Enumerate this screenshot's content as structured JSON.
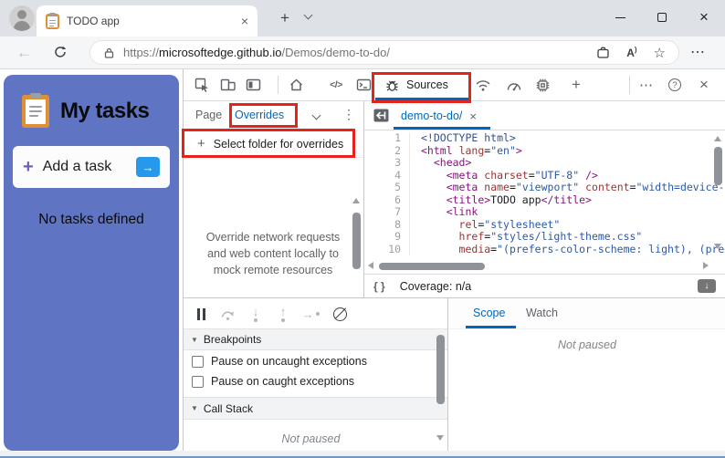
{
  "colors": {
    "accent": "#0067c0",
    "highlight": "#e5231b",
    "panel": "#5f75c3",
    "tk_tag": "#881280",
    "tk_attr": "#9a3333",
    "tk_val": "#2b59a8",
    "tk_doctype": "#33518e",
    "tk_plain": "#202124"
  },
  "browser": {
    "tab_title": "TODO app",
    "url": {
      "scheme": "https://",
      "host": "microsoftedge.github.io",
      "path": "/Demos/demo-to-do/"
    }
  },
  "app": {
    "title": "My tasks",
    "add_task": "Add a task",
    "empty": "No tasks defined"
  },
  "devtools": {
    "sources_tab": "Sources",
    "sidebar": {
      "page_tab": "Page",
      "overrides_tab": "Overrides",
      "select_folder": "Select folder for overrides",
      "placeholder": "Override network requests and web content locally to mock remote resources"
    },
    "editor": {
      "file_tab": "demo-to-do/",
      "coverage": "Coverage: n/a",
      "lines": [
        {
          "n": "1",
          "t": [
            [
              "doctype",
              "<!DOCTYPE html>"
            ]
          ]
        },
        {
          "n": "2",
          "t": [
            [
              "tag",
              "<html"
            ],
            [
              "plain",
              " "
            ],
            [
              "attr",
              "lang"
            ],
            [
              "plain",
              "="
            ],
            [
              "val",
              "\"en\""
            ],
            [
              "tag",
              ">"
            ]
          ]
        },
        {
          "n": "3",
          "t": [
            [
              "plain",
              "  "
            ],
            [
              "tag",
              "<head>"
            ]
          ]
        },
        {
          "n": "4",
          "t": [
            [
              "plain",
              "    "
            ],
            [
              "tag",
              "<meta"
            ],
            [
              "plain",
              " "
            ],
            [
              "attr",
              "charset"
            ],
            [
              "plain",
              "="
            ],
            [
              "val",
              "\"UTF-8\""
            ],
            [
              "tag",
              " />"
            ]
          ]
        },
        {
          "n": "5",
          "t": [
            [
              "plain",
              "    "
            ],
            [
              "tag",
              "<meta"
            ],
            [
              "plain",
              " "
            ],
            [
              "attr",
              "name"
            ],
            [
              "plain",
              "="
            ],
            [
              "val",
              "\"viewport\""
            ],
            [
              "plain",
              " "
            ],
            [
              "attr",
              "content"
            ],
            [
              "plain",
              "="
            ],
            [
              "val",
              "\"width=device-"
            ]
          ]
        },
        {
          "n": "6",
          "t": [
            [
              "plain",
              "    "
            ],
            [
              "tag",
              "<title>"
            ],
            [
              "plain",
              "TODO app"
            ],
            [
              "tag",
              "</title>"
            ]
          ]
        },
        {
          "n": "7",
          "t": [
            [
              "plain",
              "    "
            ],
            [
              "tag",
              "<link"
            ]
          ]
        },
        {
          "n": "8",
          "t": [
            [
              "plain",
              "      "
            ],
            [
              "attr",
              "rel"
            ],
            [
              "plain",
              "="
            ],
            [
              "val",
              "\"stylesheet\""
            ]
          ]
        },
        {
          "n": "9",
          "t": [
            [
              "plain",
              "      "
            ],
            [
              "attr",
              "href"
            ],
            [
              "plain",
              "="
            ],
            [
              "val",
              "\"styles/light-theme.css\""
            ]
          ]
        },
        {
          "n": "10",
          "t": [
            [
              "plain",
              "      "
            ],
            [
              "attr",
              "media"
            ],
            [
              "plain",
              "="
            ],
            [
              "val",
              "\"(prefers-color-scheme: light), (pre"
            ]
          ]
        }
      ]
    },
    "debugger": {
      "breakpoints_header": "Breakpoints",
      "checkboxes": [
        "Pause on uncaught exceptions",
        "Pause on caught exceptions"
      ],
      "callstack_header": "Call Stack",
      "not_paused": "Not paused"
    },
    "watch": {
      "tabs": [
        "Scope",
        "Watch"
      ],
      "not_paused": "Not paused"
    }
  },
  "icons": {
    "plus": "+",
    "close": "×",
    "more_h": "⋯",
    "kebab": "⋮",
    "star": "☆",
    "back": "←",
    "code_tag": "</>",
    "help": "?",
    "braces": "{ }",
    "triangle_down": "▼",
    "arrow_right": "→",
    "arrow_down": "↓",
    "arrow_up": "↑",
    "read_aloud": "A"
  }
}
